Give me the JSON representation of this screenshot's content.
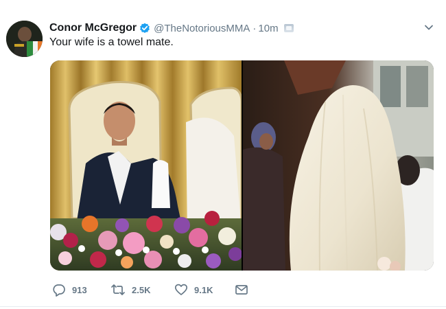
{
  "tweet": {
    "author_name": "Conor McGregor",
    "handle": "@TheNotoriousMMA",
    "separator": "·",
    "time": "10m",
    "verified": true,
    "text": "Your wife is a towel mate.",
    "media": {
      "photo_count": 2
    },
    "actions": {
      "replies": "913",
      "retweets": "2.5K",
      "likes": "9.1K"
    }
  },
  "icons": {
    "reply": "reply-icon",
    "retweet": "retweet-icon",
    "like": "heart-icon",
    "dm": "envelope-icon",
    "menu": "chevron-down-icon",
    "verified": "verified-badge-icon"
  },
  "colors": {
    "verified_blue": "#1da1f2",
    "secondary_text": "#657786",
    "primary_text": "#14171a"
  }
}
